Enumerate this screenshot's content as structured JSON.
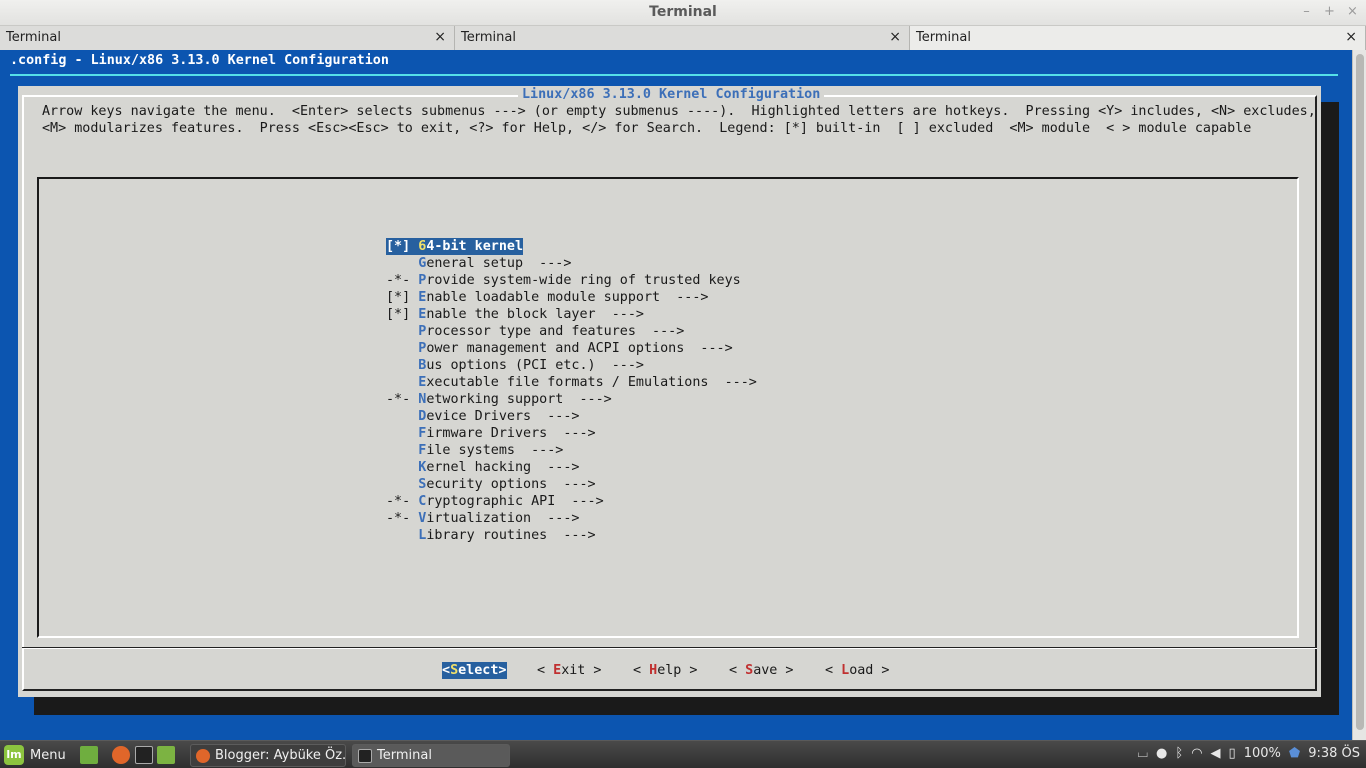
{
  "window": {
    "title": "Terminal",
    "controls": [
      "–",
      "+",
      "×"
    ]
  },
  "tabs": [
    {
      "label": "Terminal",
      "close": "×"
    },
    {
      "label": "Terminal",
      "close": "×"
    },
    {
      "label": "Terminal",
      "close": "×"
    }
  ],
  "terminal": {
    "header": ".config - Linux/x86 3.13.0 Kernel Configuration",
    "dialog_title": "Linux/x86 3.13.0 Kernel Configuration",
    "help_line1": "Arrow keys navigate the menu.  <Enter> selects submenus ---> (or empty submenus ----).  Highlighted letters are hotkeys.  Pressing <Y> includes, <N> excludes,",
    "help_line2": "<M> modularizes features.  Press <Esc><Esc> to exit, <?> for Help, </> for Search.  Legend: [*] built-in  [ ] excluded  <M> module  < > module capable",
    "menu_items": [
      {
        "prefix": "[*] ",
        "hotkey": "6",
        "rest": "4-bit kernel",
        "selected": true
      },
      {
        "prefix": "    ",
        "hotkey": "G",
        "rest": "eneral setup  --->"
      },
      {
        "prefix": "-*- ",
        "hotkey": "P",
        "rest": "rovide system-wide ring of trusted keys"
      },
      {
        "prefix": "[*] ",
        "hotkey": "E",
        "rest": "nable loadable module support  --->"
      },
      {
        "prefix": "[*] ",
        "hotkey": "E",
        "rest": "nable the block layer  --->"
      },
      {
        "prefix": "    ",
        "hotkey": "P",
        "rest": "rocessor type and features  --->"
      },
      {
        "prefix": "    ",
        "hotkey": "P",
        "rest": "ower management and ACPI options  --->"
      },
      {
        "prefix": "    ",
        "hotkey": "B",
        "rest": "us options (PCI etc.)  --->"
      },
      {
        "prefix": "    ",
        "hotkey": "E",
        "rest": "xecutable file formats / Emulations  --->"
      },
      {
        "prefix": "-*- ",
        "hotkey": "N",
        "rest": "etworking support  --->"
      },
      {
        "prefix": "    ",
        "hotkey": "D",
        "rest": "evice Drivers  --->"
      },
      {
        "prefix": "    ",
        "hotkey": "F",
        "rest": "irmware Drivers  --->"
      },
      {
        "prefix": "    ",
        "hotkey": "F",
        "rest": "ile systems  --->"
      },
      {
        "prefix": "    ",
        "hotkey": "K",
        "rest": "ernel hacking  --->"
      },
      {
        "prefix": "    ",
        "hotkey": "S",
        "rest": "ecurity options  --->"
      },
      {
        "prefix": "-*- ",
        "hotkey": "C",
        "rest": "ryptographic API  --->"
      },
      {
        "prefix": "-*- ",
        "hotkey": "V",
        "rest": "irtualization  --->"
      },
      {
        "prefix": "    ",
        "hotkey": "L",
        "rest": "ibrary routines  --->"
      }
    ],
    "buttons": [
      {
        "pre": "<",
        "hotkey": "S",
        "rest": "elect>",
        "selected": true
      },
      {
        "pre": "< ",
        "hotkey": "E",
        "rest": "xit >"
      },
      {
        "pre": "< ",
        "hotkey": "H",
        "rest": "elp >"
      },
      {
        "pre": "< ",
        "hotkey": "S",
        "rest": "ave >"
      },
      {
        "pre": "< ",
        "hotkey": "L",
        "rest": "oad >"
      }
    ]
  },
  "taskbar": {
    "menu_label": "Menu",
    "mint_logo": "lm",
    "tasks": [
      {
        "label": "Blogger: Aybüke Öz..."
      },
      {
        "label": "Terminal"
      }
    ],
    "battery": "100%",
    "clock": "9:38 ÖS",
    "colors": {
      "accent": "#8cc43f",
      "terminal_bg": "#0c55b0",
      "dialog_bg": "#d6d6d2",
      "selection": "#27609f"
    }
  }
}
